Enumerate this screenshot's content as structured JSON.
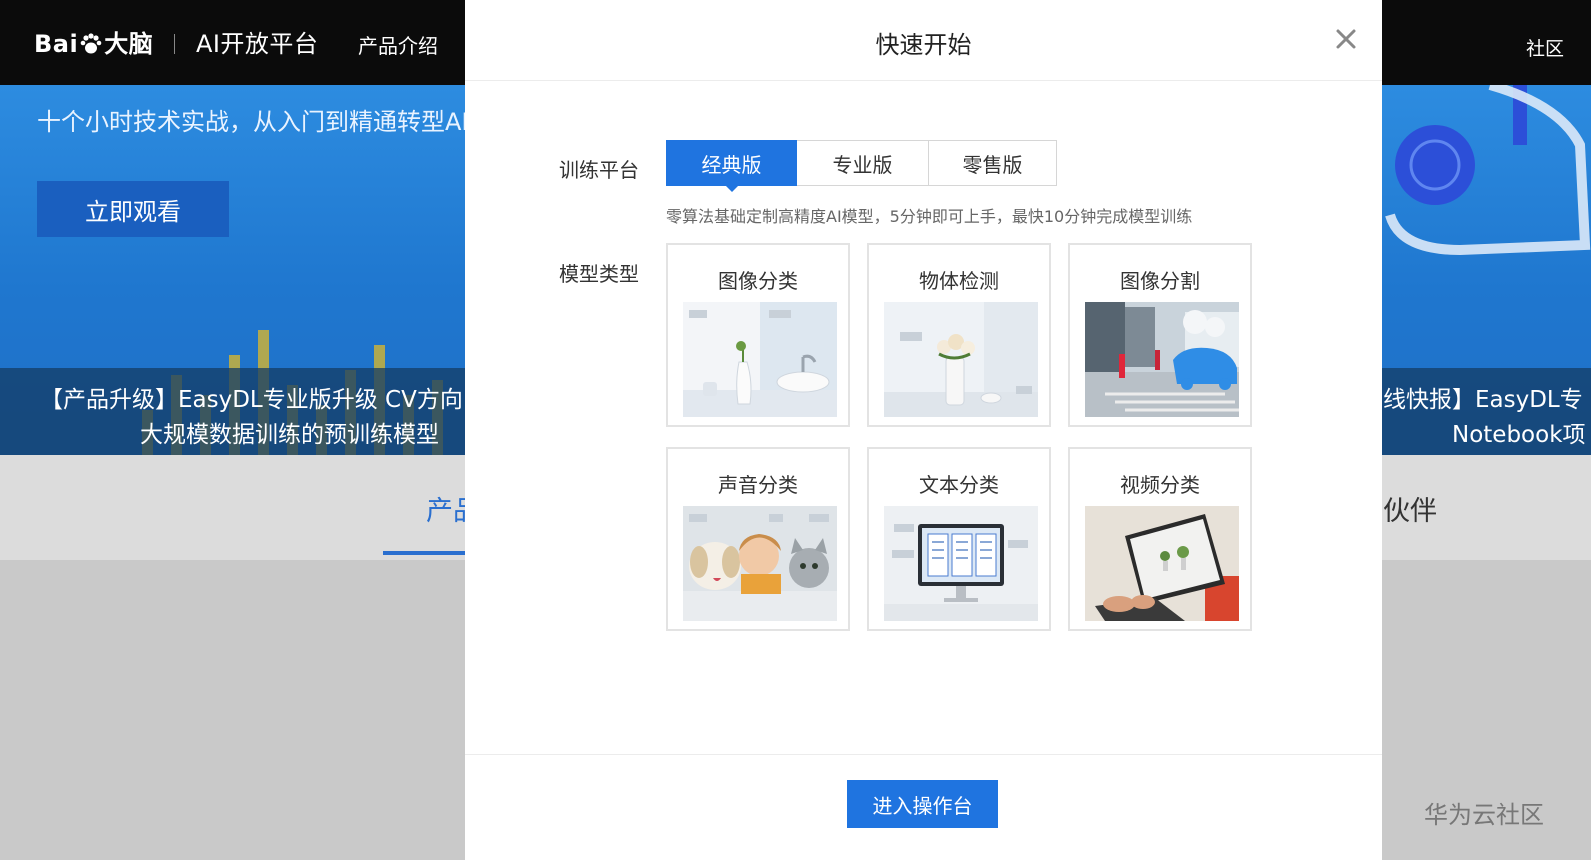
{
  "header": {
    "logo_text": "Bai",
    "logo_text2": "大脑",
    "platform": "AI开放平台",
    "nav_product": "产品介绍",
    "nav_right": "社区"
  },
  "banner": {
    "slogan": "十个小时技术实战，从入门到精通转型AI",
    "watch_button": "立即观看",
    "news_left_line1": "【产品升级】EasyDL专业版升级 CV方向",
    "news_left_line2": "大规模数据训练的预训练模型",
    "news_right_line1": "线快报】EasyDL专",
    "news_right_line2": "Notebook项"
  },
  "tabs": {
    "product": "产品",
    "partner": "伙伴"
  },
  "watermark": "华为云社区",
  "modal": {
    "title": "快速开始",
    "platform_label": "训练平台",
    "platform_options": [
      "经典版",
      "专业版",
      "零售版"
    ],
    "selected_platform": "经典版",
    "description": "零算法基础定制高精度AI模型，5分钟即可上手，最快10分钟完成模型训练",
    "model_label": "模型类型",
    "model_types": [
      {
        "title": "图像分类"
      },
      {
        "title": "物体检测"
      },
      {
        "title": "图像分割"
      },
      {
        "title": "声音分类"
      },
      {
        "title": "文本分类"
      },
      {
        "title": "视频分类"
      }
    ],
    "enter_button": "进入操作台"
  },
  "colors": {
    "accent": "#1f74e0",
    "topbar": "#0b0b0b",
    "banner": "#2d8ce0"
  }
}
